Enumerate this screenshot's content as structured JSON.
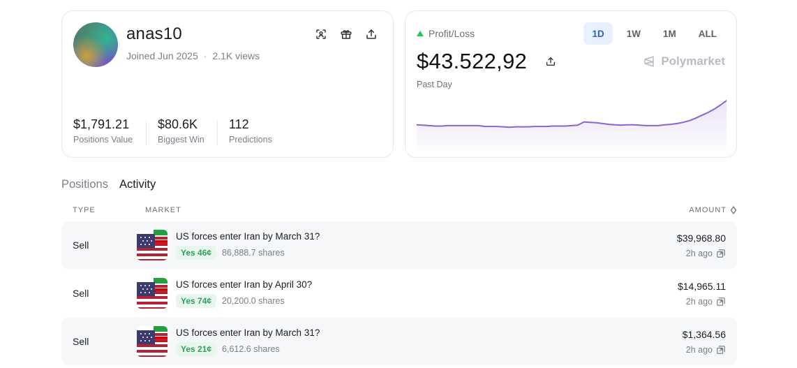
{
  "profile": {
    "username": "anas10",
    "joined": "Joined Jun 2025",
    "separator": "·",
    "views": "2.1K views",
    "icons": [
      "scan-icon",
      "gift-icon",
      "share-icon"
    ],
    "stats": [
      {
        "value": "$1,791.21",
        "label": "Positions Value"
      },
      {
        "value": "$80.6K",
        "label": "Biggest Win"
      },
      {
        "value": "112",
        "label": "Predictions"
      }
    ]
  },
  "pnl": {
    "label": "Profit/Loss",
    "value": "$43.522,92",
    "period": "Past Day",
    "brand": "Polymarket",
    "ranges": [
      "1D",
      "1W",
      "1M",
      "ALL"
    ],
    "active_range": "1D",
    "accent_color": "#22c55e"
  },
  "chart_data": {
    "type": "area",
    "x": [
      0,
      1,
      2,
      3,
      4,
      5,
      6,
      7,
      8,
      9,
      10,
      11,
      12,
      13,
      14,
      15,
      16,
      17,
      18,
      19,
      20,
      21,
      22,
      23,
      24,
      25,
      26,
      27,
      28,
      29,
      30,
      31,
      32,
      33,
      34,
      35,
      36,
      37,
      38,
      39,
      40,
      41,
      42,
      43,
      44,
      45,
      46,
      47,
      48,
      49,
      50
    ],
    "values": [
      60,
      59,
      58,
      57,
      57,
      58,
      58,
      58,
      58,
      58,
      58,
      56,
      56,
      56,
      55,
      54,
      55,
      55,
      55,
      56,
      56,
      56,
      57,
      57,
      57,
      58,
      59,
      67,
      66,
      65,
      63,
      61,
      60,
      59,
      60,
      60,
      59,
      58,
      58,
      58,
      60,
      61,
      63,
      66,
      70,
      76,
      83,
      90,
      98,
      108,
      119
    ],
    "line_color": "#8a63d2",
    "grid": false,
    "axes_visible": false
  },
  "tabs": [
    {
      "label": "Positions",
      "active": false
    },
    {
      "label": "Activity",
      "active": true
    }
  ],
  "table": {
    "headers": {
      "type": "TYPE",
      "market": "MARKET",
      "amount": "AMOUNT"
    },
    "rows": [
      {
        "type": "Sell",
        "market": "US forces enter Iran by March 31?",
        "outcome": "Yes 46¢",
        "shares": "86,888.7 shares",
        "amount": "$39,968.80",
        "time": "2h ago",
        "shaded": true
      },
      {
        "type": "Sell",
        "market": "US forces enter Iran by April 30?",
        "outcome": "Yes 74¢",
        "shares": "20,200.0 shares",
        "amount": "$14,965.11",
        "time": "2h ago",
        "shaded": false
      },
      {
        "type": "Sell",
        "market": "US forces enter Iran by March 31?",
        "outcome": "Yes 21¢",
        "shares": "6,612.6 shares",
        "amount": "$1,364.56",
        "time": "2h ago",
        "shaded": true
      }
    ]
  }
}
